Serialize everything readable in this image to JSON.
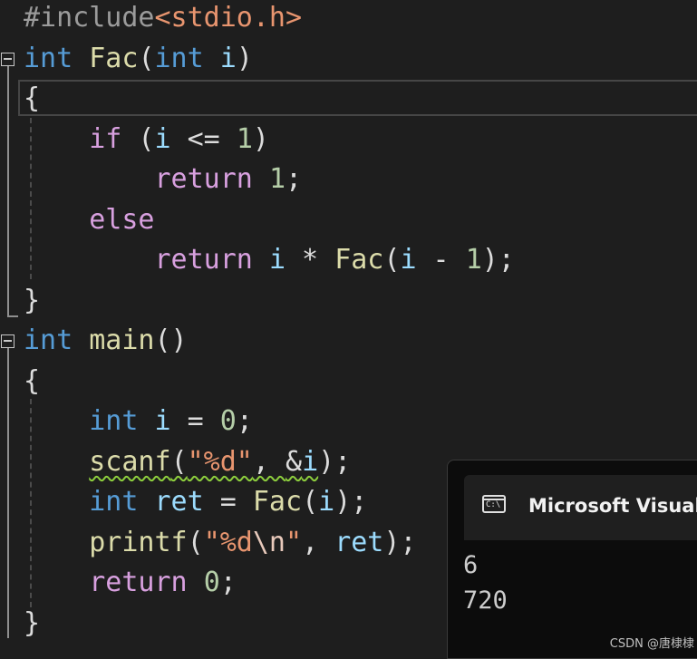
{
  "editor": {
    "lines": [
      {
        "tokens": [
          {
            "t": "#include",
            "c": "pre"
          },
          {
            "t": "<stdio.h>",
            "c": "inc"
          }
        ]
      },
      {
        "tokens": [
          {
            "t": "int",
            "c": "kw"
          },
          {
            "t": " ",
            "c": "pun"
          },
          {
            "t": "Fac",
            "c": "fn"
          },
          {
            "t": "(",
            "c": "pun"
          },
          {
            "t": "int",
            "c": "kw"
          },
          {
            "t": " ",
            "c": "pun"
          },
          {
            "t": "i",
            "c": "var"
          },
          {
            "t": ")",
            "c": "pun"
          }
        ]
      },
      {
        "tokens": [
          {
            "t": "{",
            "c": "pun"
          }
        ]
      },
      {
        "tokens": [
          {
            "t": "    ",
            "c": "pun"
          },
          {
            "t": "if",
            "c": "ctl"
          },
          {
            "t": " (",
            "c": "pun"
          },
          {
            "t": "i",
            "c": "var"
          },
          {
            "t": " <= ",
            "c": "op"
          },
          {
            "t": "1",
            "c": "num"
          },
          {
            "t": ")",
            "c": "pun"
          }
        ]
      },
      {
        "tokens": [
          {
            "t": "        ",
            "c": "pun"
          },
          {
            "t": "return",
            "c": "ctl"
          },
          {
            "t": " ",
            "c": "pun"
          },
          {
            "t": "1",
            "c": "num"
          },
          {
            "t": ";",
            "c": "pun"
          }
        ]
      },
      {
        "tokens": [
          {
            "t": "    ",
            "c": "pun"
          },
          {
            "t": "else",
            "c": "ctl"
          }
        ]
      },
      {
        "tokens": [
          {
            "t": "        ",
            "c": "pun"
          },
          {
            "t": "return",
            "c": "ctl"
          },
          {
            "t": " ",
            "c": "pun"
          },
          {
            "t": "i",
            "c": "var"
          },
          {
            "t": " * ",
            "c": "op"
          },
          {
            "t": "Fac",
            "c": "fn"
          },
          {
            "t": "(",
            "c": "pun"
          },
          {
            "t": "i",
            "c": "var"
          },
          {
            "t": " - ",
            "c": "op"
          },
          {
            "t": "1",
            "c": "num"
          },
          {
            "t": ");",
            "c": "pun"
          }
        ]
      },
      {
        "tokens": [
          {
            "t": "}",
            "c": "pun"
          }
        ]
      },
      {
        "tokens": [
          {
            "t": "int",
            "c": "kw"
          },
          {
            "t": " ",
            "c": "pun"
          },
          {
            "t": "main",
            "c": "fn"
          },
          {
            "t": "()",
            "c": "pun"
          }
        ]
      },
      {
        "tokens": [
          {
            "t": "{",
            "c": "pun"
          }
        ]
      },
      {
        "tokens": [
          {
            "t": "    ",
            "c": "pun"
          },
          {
            "t": "int",
            "c": "kw"
          },
          {
            "t": " ",
            "c": "pun"
          },
          {
            "t": "i",
            "c": "var"
          },
          {
            "t": " = ",
            "c": "op"
          },
          {
            "t": "0",
            "c": "num"
          },
          {
            "t": ";",
            "c": "pun"
          }
        ]
      },
      {
        "tokens": [
          {
            "t": "    ",
            "c": "pun"
          },
          {
            "t": "scanf",
            "c": "fn",
            "sq": true
          },
          {
            "t": "(",
            "c": "pun",
            "sq": true
          },
          {
            "t": "\"%d\"",
            "c": "str",
            "sq": true
          },
          {
            "t": ", ",
            "c": "pun",
            "sq": true
          },
          {
            "t": "&",
            "c": "op",
            "sq": true
          },
          {
            "t": "i",
            "c": "var",
            "sq": true
          },
          {
            "t": ");",
            "c": "pun"
          }
        ]
      },
      {
        "tokens": [
          {
            "t": "    ",
            "c": "pun"
          },
          {
            "t": "int",
            "c": "kw"
          },
          {
            "t": " ",
            "c": "pun"
          },
          {
            "t": "ret",
            "c": "var"
          },
          {
            "t": " = ",
            "c": "op"
          },
          {
            "t": "Fac",
            "c": "fn"
          },
          {
            "t": "(",
            "c": "pun"
          },
          {
            "t": "i",
            "c": "var"
          },
          {
            "t": ");",
            "c": "pun"
          }
        ]
      },
      {
        "tokens": [
          {
            "t": "    ",
            "c": "pun"
          },
          {
            "t": "printf",
            "c": "fn"
          },
          {
            "t": "(",
            "c": "pun"
          },
          {
            "t": "\"%d",
            "c": "str"
          },
          {
            "t": "\\n",
            "c": "esc"
          },
          {
            "t": "\"",
            "c": "str"
          },
          {
            "t": ", ",
            "c": "pun"
          },
          {
            "t": "ret",
            "c": "var"
          },
          {
            "t": ");",
            "c": "pun"
          }
        ]
      },
      {
        "tokens": [
          {
            "t": "    ",
            "c": "pun"
          },
          {
            "t": "return",
            "c": "ctl"
          },
          {
            "t": " ",
            "c": "pun"
          },
          {
            "t": "0",
            "c": "num"
          },
          {
            "t": ";",
            "c": "pun"
          }
        ]
      },
      {
        "tokens": [
          {
            "t": "}",
            "c": "pun"
          }
        ]
      }
    ]
  },
  "console": {
    "icon_name": "console-app-icon",
    "icon_text": "C:\\",
    "title": "Microsoft Visual",
    "output": [
      "6",
      "720"
    ]
  },
  "watermark": "CSDN @唐棣棣"
}
